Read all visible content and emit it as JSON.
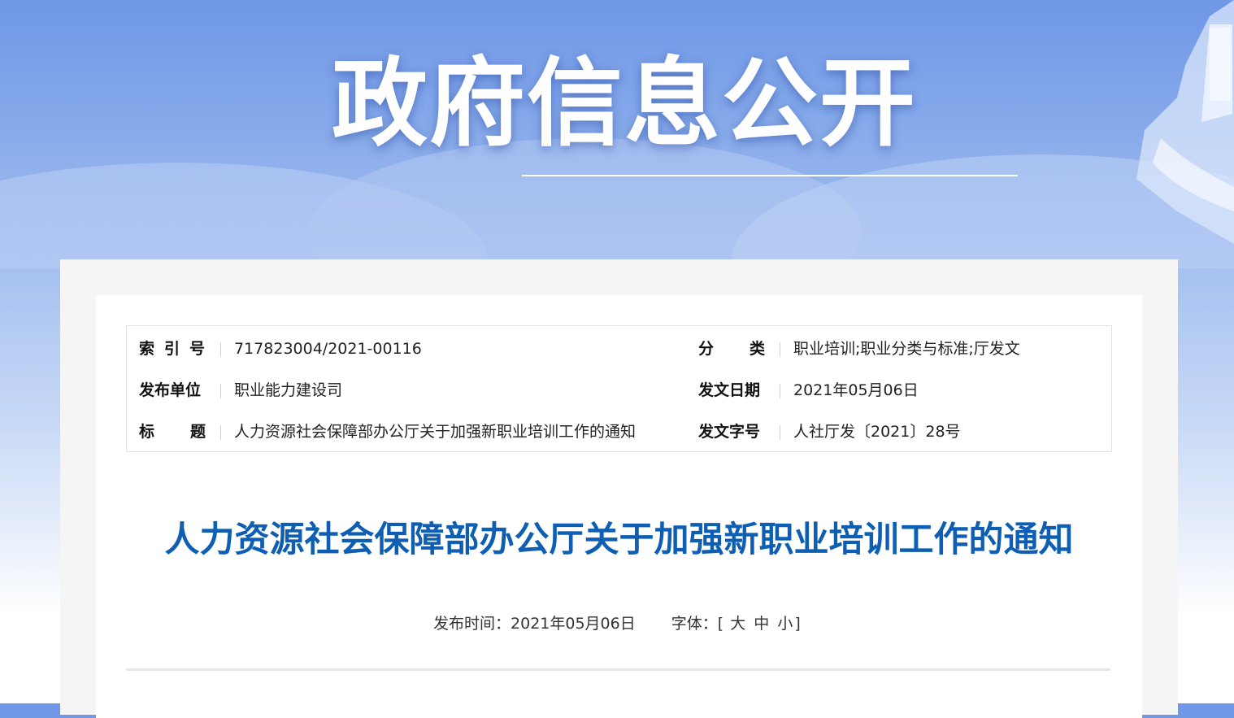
{
  "banner": {
    "title": "政府信息公开",
    "colors": {
      "sky_top": "#6f97e6",
      "sky_mid": "#a6c1f0",
      "title_text": "#ffffff"
    }
  },
  "meta": {
    "rows": [
      {
        "left_label": "索引号",
        "left_value": "717823004/2021-00116",
        "right_label": "分类",
        "right_value": "职业培训;职业分类与标准;厅发文"
      },
      {
        "left_label": "发布单位",
        "left_value": "职业能力建设司",
        "right_label": "发文日期",
        "right_value": "2021年05月06日"
      },
      {
        "left_label": "标题",
        "left_value": "人力资源社会保障部办公厅关于加强新职业培训工作的通知",
        "right_label": "发文字号",
        "right_value": "人社厅发〔2021〕28号"
      }
    ]
  },
  "article": {
    "title": "人力资源社会保障部办公厅关于加强新职业培训工作的通知",
    "publish_label": "发布时间：",
    "publish_date": "2021年05月06日",
    "font_size_label": "字体：",
    "font_size_open": "[",
    "font_size_options": [
      "大",
      "中",
      "小"
    ],
    "font_size_close": "]",
    "title_color": "#0e5fb3"
  }
}
